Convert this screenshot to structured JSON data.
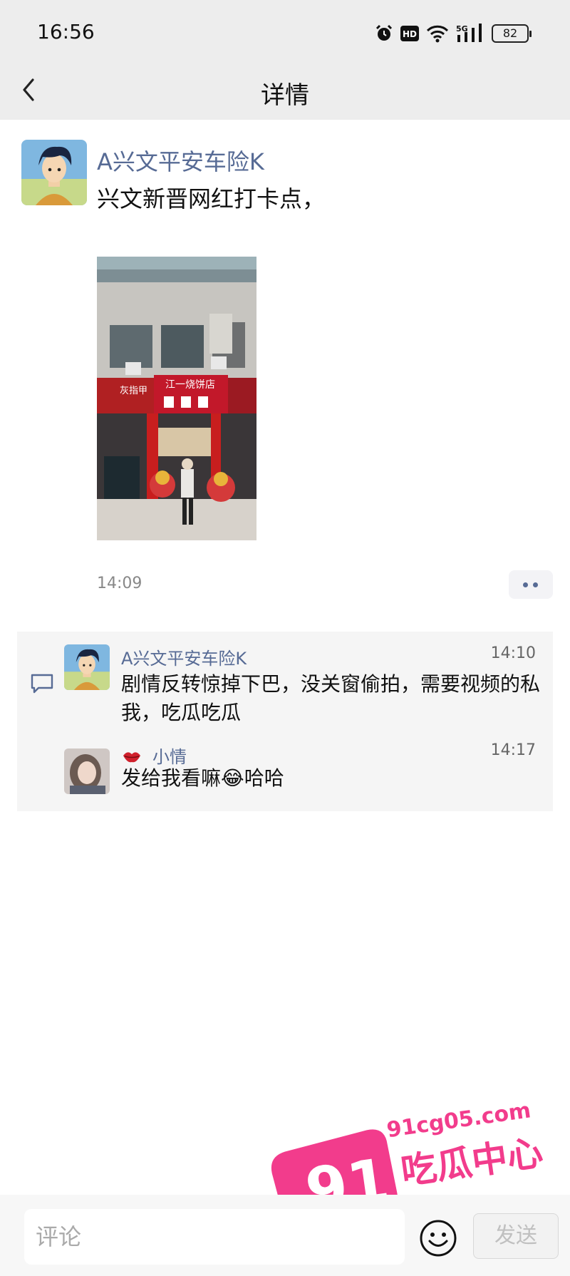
{
  "status_bar": {
    "time": "16:56",
    "battery": "82",
    "network": "5G"
  },
  "nav": {
    "title": "详情"
  },
  "post": {
    "author": "A兴文平安车险K",
    "text": "兴文新晋网红打卡点，",
    "time": "14:09",
    "photo_signs": {
      "left_sign": "灰指甲",
      "center_sign": "江一烧饼店"
    }
  },
  "comments": [
    {
      "name": "A兴文平安车险K",
      "time": "14:10",
      "text": "剧情反转惊掉下巴，没关窗偷拍，需要视频的私我，吃瓜吃瓜"
    },
    {
      "name": "小情",
      "time": "14:17",
      "text": "发给我看嘛😂哈哈"
    }
  ],
  "input": {
    "placeholder": "评论",
    "send": "发送"
  },
  "watermark": {
    "number": "91",
    "site": "91cg05.com",
    "brand": "吃瓜中心"
  },
  "colors": {
    "link_blue": "#576b95",
    "header_gray": "#ededed",
    "watermark_pink": "#f23c8c"
  }
}
